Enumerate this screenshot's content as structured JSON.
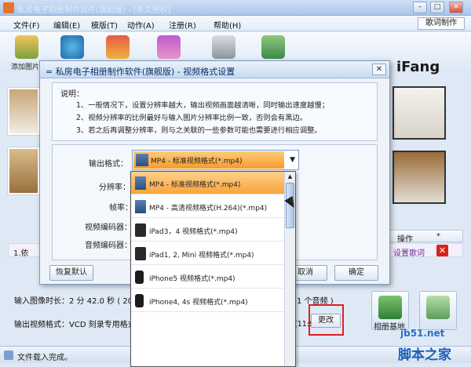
{
  "window": {
    "title": "私房电子相册制作软件(旗舰版) - [永久授权]",
    "minimize": "–",
    "maximize": "□",
    "close": "✕"
  },
  "menu": {
    "items": [
      "文件(F)",
      "编辑(E)",
      "模版(T)",
      "动作(A)",
      "注册(R)",
      "帮助(H)"
    ],
    "right": "歌词制作"
  },
  "toolbar": {
    "add_label": "添加图片"
  },
  "brand": "iFang",
  "list": {
    "col_action": "操作",
    "col_star": "*",
    "row_file": "1.依",
    "row_action": "设置歌词",
    "delete": "✕"
  },
  "info": {
    "duration": "输入图像时长：2 分 42.0 秒 ( 20 张",
    "audio": "1 个音频 )",
    "out_format": "输出视频格式：VCD 刻录专用格式(*.mpg)",
    "out_res": "输出视频分辨率：352*288 (11:9)",
    "change": "更改",
    "album_btn": "相册基地"
  },
  "status": {
    "text": "文件载入完成。"
  },
  "watermark": {
    "site": "jb51.net",
    "name": "脚本之家"
  },
  "dialog": {
    "title": "= 私房电子相册制作软件(旗舰版) - 视频格式设置",
    "close": "✕",
    "notes_heading": "说明：",
    "notes": [
      "1、一般情况下，设置分辨率越大，输出视频画面越清晰，同时输出速度越慢；",
      "2、视频分辨率的比例最好与输入图片分辨率比例一致，否则会有黑边。",
      "3、若之后再调整分辨率，则与之关联的一些参数可能也需要进行相应调整。"
    ],
    "label_format": "输出格式：",
    "label_res": "分辨率：",
    "label_fps": "帧率：",
    "label_venc": "视频编码器：",
    "label_aenc": "音频编码器：",
    "combo_value": "MP4 - 标准视频格式(*.mp4)",
    "options": [
      "MP4 - 标准视频格式(*.mp4)",
      "MP4 - 高清视频格式(H.264)(*.mp4)",
      "iPad3，4 视频格式(*.mp4)",
      "iPad1, 2, Mini 视频格式(*.mp4)",
      "iPhone5 视频格式(*.mp4)",
      "iPhone4, 4s 视频格式(*.mp4)"
    ],
    "reset": "恢复默认",
    "cancel": "取消",
    "ok": "确定"
  }
}
